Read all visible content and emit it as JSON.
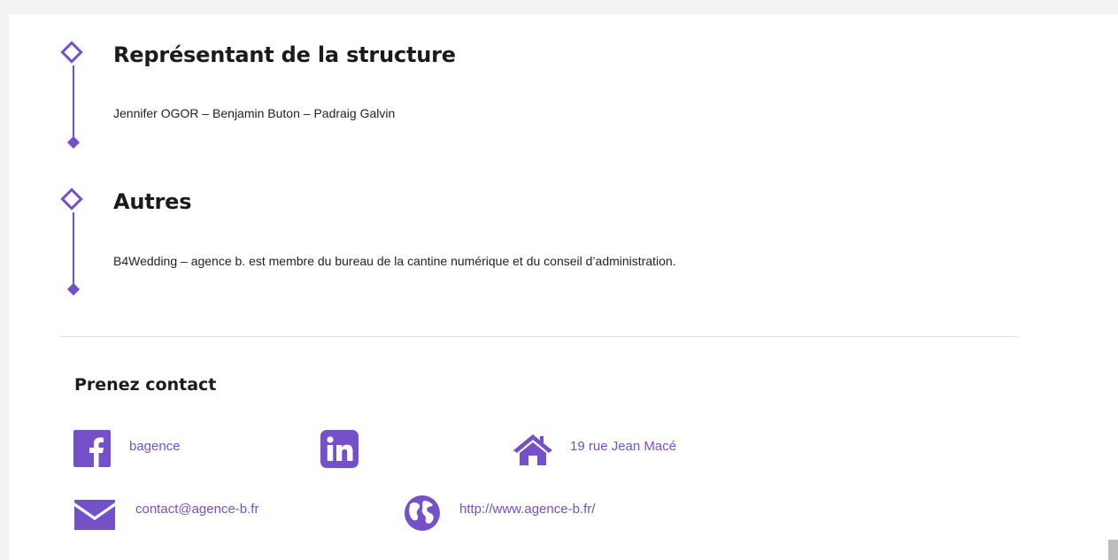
{
  "sections": [
    {
      "title": "Représentant de la structure",
      "text": "Jennifer OGOR – Benjamin Buton – Padraig Galvin"
    },
    {
      "title": "Autres",
      "text": "B4Wedding – agence b. est membre du bureau de la cantine numérique et du conseil d’administration."
    }
  ],
  "contact": {
    "title": "Prenez contact",
    "facebook": {
      "icon": "facebook-icon",
      "label": "bagence"
    },
    "linkedin": {
      "icon": "linkedin-icon"
    },
    "address": {
      "icon": "home-icon",
      "label": "19 rue Jean Macé"
    },
    "email": {
      "icon": "envelope-icon",
      "label": "contact@agence-b.fr"
    },
    "website": {
      "icon": "globe-icon",
      "label": "http://www.agence-b.fr/"
    }
  },
  "colors": {
    "accent": "#7551c9",
    "title_text": "#1b1b1b",
    "divider": "#dedede"
  }
}
